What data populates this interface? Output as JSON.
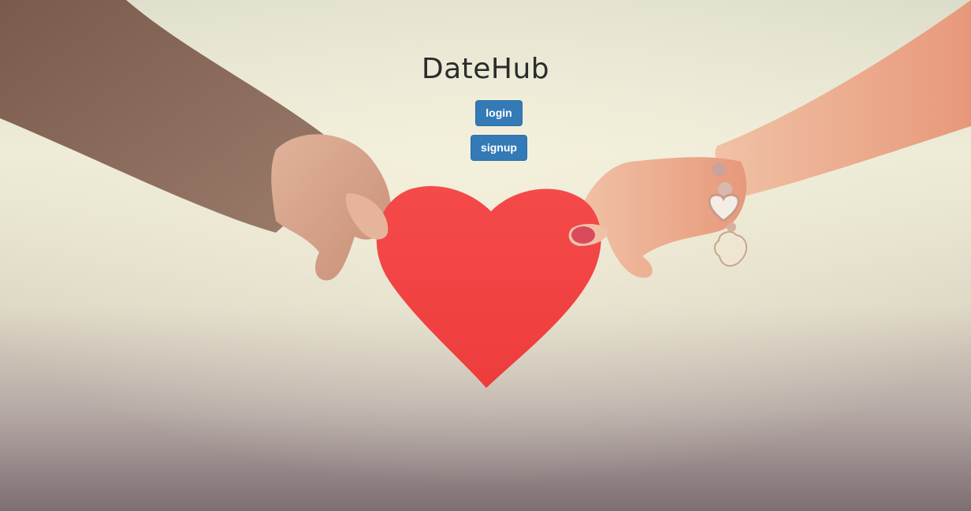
{
  "page": {
    "title": "DateHub"
  },
  "actions": {
    "login_label": "login",
    "signup_label": "signup"
  },
  "theme": {
    "button_color": "#337ab7",
    "button_border": "#2e6da4",
    "title_color": "#2b2b2b",
    "heart_color": "#f04848"
  },
  "background": {
    "description_icon": "heart-hands-photo"
  }
}
